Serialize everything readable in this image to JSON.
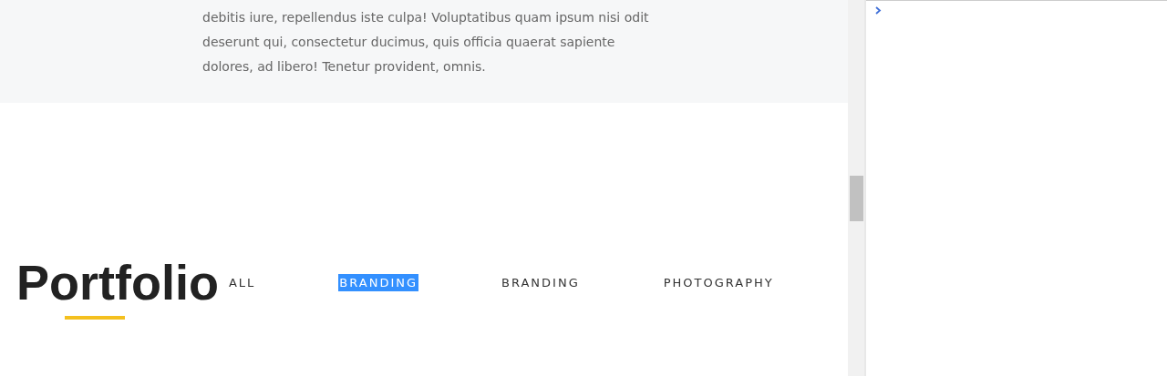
{
  "intro": {
    "lines": [
      "debitis iure, repellendus iste culpa! Voluptatibus quam ipsum nisi odit",
      "deserunt qui, consectetur ducimus, quis officia quaerat sapiente",
      "dolores, ad libero! Tenetur provident, omnis."
    ]
  },
  "portfolio": {
    "title": "Portfolio",
    "filters": [
      {
        "label": "ALL",
        "selected": false
      },
      {
        "label": "BRANDING",
        "selected": true
      },
      {
        "label": "BRANDING",
        "selected": false
      },
      {
        "label": "PHOTOGRAPHY",
        "selected": false
      }
    ]
  }
}
